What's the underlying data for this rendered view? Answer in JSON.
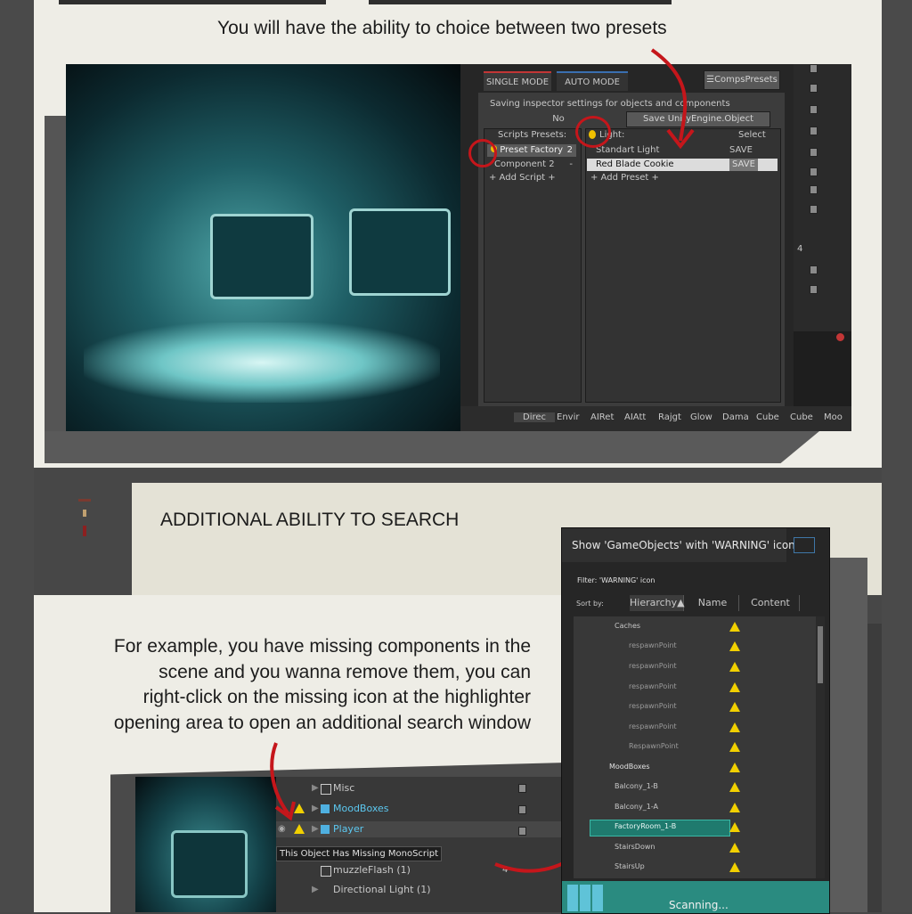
{
  "header_caption": "You will have the ability to choice between two presets",
  "inspector": {
    "tabs": [
      "SINGLE MODE",
      "AUTO MODE"
    ],
    "comps_presets_label": "☰CompsPresets",
    "saving_text": "Saving inspector settings for objects and components",
    "no_label": "No",
    "save_object_label": "Save UnityEngine.Object",
    "scripts_presets_label": "Scripts Presets:",
    "scripts": [
      {
        "name": "Preset Factory",
        "count": "2"
      },
      {
        "name": "Component 2",
        "count": "-"
      }
    ],
    "add_script_label": "+ Add Script +",
    "light_label": "Light:",
    "select_label": "Select",
    "presets": [
      {
        "name": "Standart Light",
        "save": "SAVE"
      },
      {
        "name": "Red Blade Cookie",
        "save": "SAVE"
      }
    ],
    "add_preset_label": "+ Add Preset +",
    "bottom_tabs": [
      "Direc",
      "Envir",
      "AIRet",
      "AIAtt",
      "Rajgt",
      "Glow",
      "Dama",
      "Cube",
      "Cube",
      "Moo"
    ],
    "right_count": "4"
  },
  "section2_title": "ADDITIONAL ABILITY TO SEARCH",
  "example_text": [
    "For example, you have missing components in the",
    "scene and you wanna remove them, you can",
    "right-click on the missing icon at the highlighter",
    "opening area to open an additional search window"
  ],
  "search_window": {
    "title": "Show 'GameObjects' with 'WARNING' icon",
    "filter_label": "Filter: 'WARNING' icon",
    "sort_by_label": "Sort by:",
    "sort_options": [
      "Hierarchy▲",
      "Name",
      "Content"
    ],
    "items": [
      {
        "name": "Caches",
        "indent": 1
      },
      {
        "name": "respawnPoint",
        "indent": 2
      },
      {
        "name": "respawnPoint",
        "indent": 2
      },
      {
        "name": "respawnPoint",
        "indent": 2
      },
      {
        "name": "respawnPoint",
        "indent": 2
      },
      {
        "name": "respawnPoint",
        "indent": 2
      },
      {
        "name": "RespawnPoint",
        "indent": 2
      },
      {
        "name": "MoodBoxes",
        "indent": 0
      },
      {
        "name": "Balcony_1-B",
        "indent": 1
      },
      {
        "name": "Balcony_1-A",
        "indent": 1
      },
      {
        "name": "FactoryRoom_1-B",
        "indent": 1,
        "selected": true
      },
      {
        "name": "StairsDown",
        "indent": 1
      },
      {
        "name": "StairsUp",
        "indent": 1
      }
    ],
    "scanning_label": "Scanning..."
  },
  "hierarchy": {
    "rows": [
      "Misc",
      "MoodBoxes",
      "Player",
      "",
      "muzzleFlash (1)",
      "Directional Light (1)"
    ],
    "tooltip": "This Object Has Missing MonoScript",
    "count": "4"
  },
  "colors": {
    "accent_teal": "#2a8b80",
    "warning": "#f1d000",
    "highlight_red": "#c5161b",
    "page_bg": "#eeede6"
  }
}
